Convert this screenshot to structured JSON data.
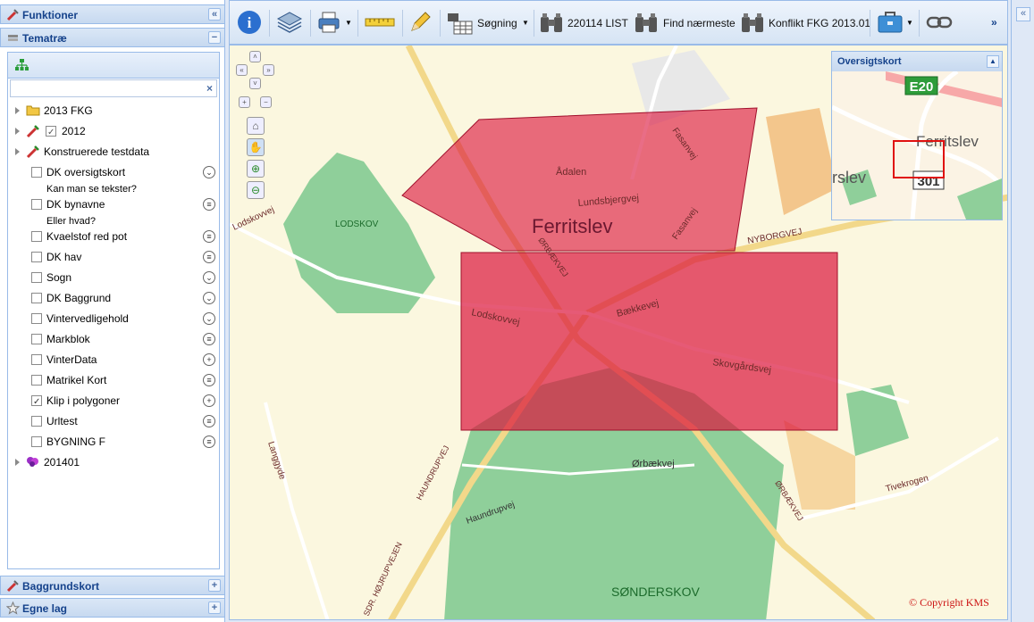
{
  "left_panel": {
    "funktioner_title": "Funktioner",
    "temat_title": "Tematræ",
    "baggrund_title": "Baggrundskort",
    "egne_title": "Egne lag",
    "search_placeholder": "",
    "tree": [
      {
        "label": "2013 FKG",
        "type": "folder"
      },
      {
        "label": "2012",
        "type": "group"
      },
      {
        "label": "Konstruerede testdata",
        "type": "group"
      },
      {
        "label": "DK oversigtskort",
        "checked": false,
        "control": "chevron"
      },
      {
        "label": "Kan man se tekster?",
        "type": "note"
      },
      {
        "label": "DK bynavne",
        "checked": false,
        "control": "list"
      },
      {
        "label": "Eller hvad?",
        "type": "note"
      },
      {
        "label": "Kvaelstof red pot",
        "checked": false,
        "control": "list"
      },
      {
        "label": "DK hav",
        "checked": false,
        "control": "list"
      },
      {
        "label": "Sogn",
        "checked": false,
        "control": "chevron"
      },
      {
        "label": "DK Baggrund",
        "checked": false,
        "control": "chevron"
      },
      {
        "label": "Vintervedligehold",
        "checked": false,
        "control": "chevron"
      },
      {
        "label": "Markblok",
        "checked": false,
        "control": "list"
      },
      {
        "label": "VinterData",
        "checked": false,
        "control": "plus"
      },
      {
        "label": "Matrikel Kort",
        "checked": false,
        "control": "list"
      },
      {
        "label": "Klip i polygoner",
        "checked": true,
        "control": "plus"
      },
      {
        "label": "Urltest",
        "checked": false,
        "control": "list"
      },
      {
        "label": "BYGNING F",
        "checked": false,
        "control": "list"
      },
      {
        "label": "201401",
        "type": "group"
      }
    ]
  },
  "toolbar": {
    "search_label": "Søgning",
    "list_label": "220114 LIST",
    "nearest_label": "Find nærmeste",
    "conflict_label": "Konflikt FKG 2013.01",
    "more_label": "»"
  },
  "map": {
    "town_label": "Ferritslev",
    "forest1": "LODSKOV",
    "forest2": "SØNDERSKOV",
    "roads": [
      "Ådalen",
      "Fasanvej",
      "Lundsbjergvej",
      "Fasanvej",
      "NYBORGVEJ",
      "ØRBÆKVEJ",
      "Lodskovvej",
      "Bækkevej",
      "Skovgårdsvej",
      "Lodskovvej",
      "Ørbækvej",
      "HAUNDRUPVEJ",
      "Haundrupvej",
      "ØRBÆKVEJ",
      "Tivekrogen",
      "Langgyde",
      "SDR. HØJRUPVEJEN"
    ],
    "copyright": "© Copyright KMS"
  },
  "overview": {
    "title": "Oversigtskort",
    "road_badge": "E20",
    "route_badge": "301",
    "town_label": "Ferritslev",
    "town_label_partial": "rslev"
  },
  "colors": {
    "polygon": "#dc143c",
    "forest": "#8fcf9a",
    "panel_header": "#15428b"
  }
}
